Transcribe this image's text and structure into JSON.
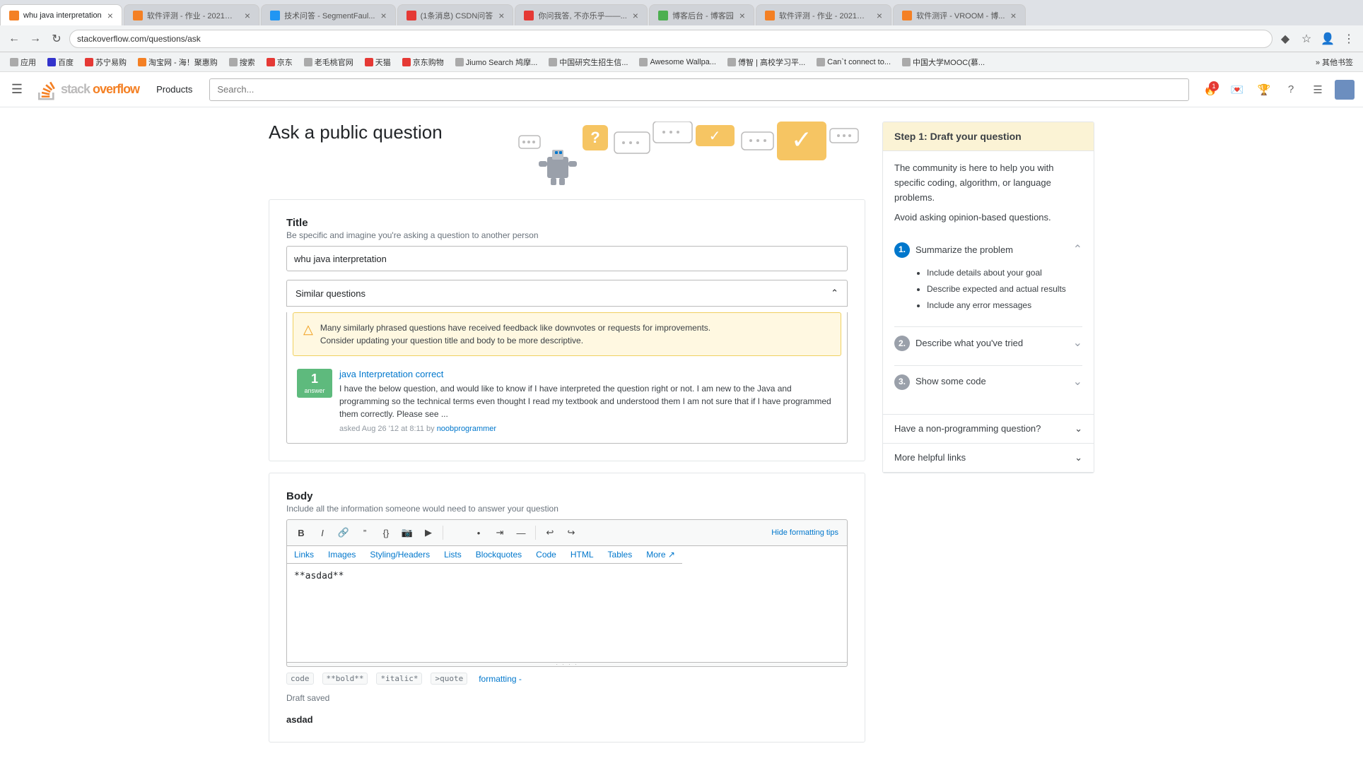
{
  "browser": {
    "tabs": [
      {
        "id": "so1",
        "favicon_type": "so",
        "text": "软件评测 - 作业 - 2021年...",
        "active": false,
        "closeable": true
      },
      {
        "id": "whu",
        "favicon_type": "so",
        "text": "whu java interpretation",
        "active": true,
        "closeable": true
      },
      {
        "id": "sf",
        "favicon_type": "sf",
        "text": "技术问答 - SegmentFaul...",
        "active": false,
        "closeable": true
      },
      {
        "id": "csdn",
        "favicon_type": "c",
        "text": "(1条消息) CSDN问答",
        "active": false,
        "closeable": true
      },
      {
        "id": "n",
        "favicon_type": "n",
        "text": "你问我答, 不亦乐乎——...",
        "active": false,
        "closeable": true
      },
      {
        "id": "b",
        "favicon_type": "b",
        "text": "博客后台 - 博客园",
        "active": false,
        "closeable": true
      },
      {
        "id": "so2",
        "favicon_type": "so",
        "text": "软件评测 - 作业 - 2021年...",
        "active": false,
        "closeable": true
      },
      {
        "id": "sw",
        "favicon_type": "sw",
        "text": "软件测评 - VROOM - 博...",
        "active": false,
        "closeable": true
      }
    ],
    "address": "stackoverflow.com/questions/ask",
    "bookmarks": [
      "应用",
      "百度",
      "苏宁易购",
      "淘宝网 - 海！聚惠购",
      "搜索",
      "京东",
      "老毛桃官网",
      "天猫",
      "京东购物",
      "Jiumo Search 鸠摩...",
      "中国研究生招生信...",
      "Awesome Wallpa...",
      "傅智 | 高校学习平...",
      "Can`t connect to...",
      "中国大学MOOC(慕..."
    ],
    "more_bookmarks": "其他书签"
  },
  "header": {
    "logo_text": "stack overflow",
    "products_label": "Products",
    "search_placeholder": "Search...",
    "icons": [
      "inbox-icon",
      "achievements-icon",
      "help-icon",
      "review-icon",
      "hamburger-icon"
    ],
    "notification_count": "1"
  },
  "page": {
    "title": "Ask a public question"
  },
  "title_field": {
    "label": "Title",
    "hint": "Be specific and imagine you're asking a question to another person",
    "value": "whu java interpretation"
  },
  "similar_questions": {
    "label": "Similar questions",
    "warning": {
      "text1": "Many similarly phrased questions have received feedback like downvotes or requests for improvements.",
      "text2": "Consider updating your question title and body to be more descriptive."
    },
    "result": {
      "answer_count": "1",
      "answer_label": "answer",
      "title": "java Interpretation correct",
      "excerpt": "I have the below question, and would like to know if I have interpreted the question right or not. I am new to the Java and programming so the technical terms even thought I read my textbook and understood them I am not sure that if I have programmed them correctly. Please see ...",
      "meta_asked": "asked Aug 26 '12 at 8:11 by",
      "meta_user": "noobprogrammer"
    }
  },
  "body_field": {
    "label": "Body",
    "hint": "Include all the information someone would need to answer your question",
    "toolbar": {
      "hide_formatting_btn": "Hide formatting tips",
      "tabs": [
        "Links",
        "Images",
        "Styling/Headers",
        "Lists",
        "Blockquotes",
        "Code",
        "HTML",
        "Tables",
        "More ↗"
      ]
    },
    "content": "**asdad**",
    "format_hints": {
      "code_label": "code",
      "bold_label": "**bold**",
      "italic_label": "*italic*",
      "quote_label": ">quote"
    },
    "draft_status": "Draft saved",
    "preview_label": "asdad"
  },
  "sidebar": {
    "card_title": "Step 1: Draft your question",
    "intro_text1": "The community is here to help you with specific coding, algorithm, or language problems.",
    "intro_text2": "Avoid asking opinion-based questions.",
    "steps": [
      {
        "number": "1.",
        "title": "Summarize the problem",
        "expanded": true,
        "bullet_points": [
          "Include details about your goal",
          "Describe expected and actual results",
          "Include any error messages"
        ]
      },
      {
        "number": "2.",
        "title": "Describe what you've tried",
        "expanded": false
      },
      {
        "number": "3.",
        "title": "Show some code",
        "expanded": false
      }
    ],
    "accordion_items": [
      {
        "label": "Have a non-programming question?"
      },
      {
        "label": "More helpful links"
      }
    ]
  }
}
